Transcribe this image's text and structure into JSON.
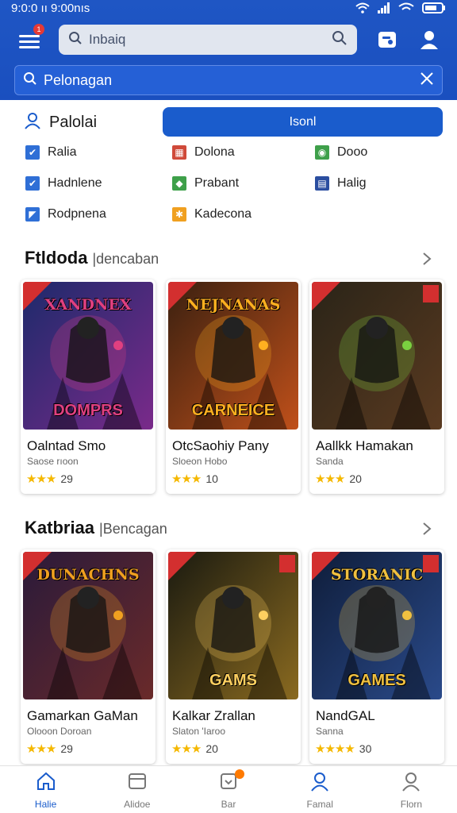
{
  "status_bar": {
    "time": "9:0:0 ıı 9:00nıs"
  },
  "header": {
    "menu_badge": "1",
    "search_text": "Inbaiq",
    "search_secondary": "Pelonagan"
  },
  "filters": {
    "profile_label": "Palolai",
    "primary_button": "Isonl",
    "items": [
      {
        "label": "Ralia",
        "color": "#2f6fd6",
        "glyph": "✔"
      },
      {
        "label": "Dolona",
        "color": "#d04a3a",
        "glyph": "▦"
      },
      {
        "label": "Dooo",
        "color": "#3ea04a",
        "glyph": "◉"
      },
      {
        "label": "Hadnlene",
        "color": "#2f6fd6",
        "glyph": "✔"
      },
      {
        "label": "Prabant",
        "color": "#3ea04a",
        "glyph": "◆"
      },
      {
        "label": "Halig",
        "color": "#2b4ea0",
        "glyph": "▤"
      },
      {
        "label": "Rodpnena",
        "color": "#2f6fd6",
        "glyph": "◤"
      },
      {
        "label": "Kadecona",
        "color": "#f0a020",
        "glyph": "✱"
      }
    ]
  },
  "sections": [
    {
      "title": "Ftldoda",
      "subtitle": "|dencaban",
      "cards": [
        {
          "title": "Oalntad Smo",
          "subtitle": "Saose rıoon",
          "rating_stars": 3,
          "rating": "29",
          "art_text": "XANDNEX",
          "art_bottom": "DOMPRS",
          "bg1": "#1d2a6b",
          "bg2": "#7a2a8a",
          "accent": "#e04080",
          "ribbon": true,
          "corner": false
        },
        {
          "title": "OtcSaohiy Pany",
          "subtitle": "Sloeon Hobo",
          "rating_stars": 3,
          "rating": "10",
          "art_text": "NEJNANAS",
          "art_bottom": "CARNEICE",
          "bg1": "#3a2010",
          "bg2": "#c0501a",
          "accent": "#ffb020",
          "ribbon": true,
          "corner": false
        },
        {
          "title": "Aallkk Hamakan",
          "subtitle": "Sanda",
          "rating_stars": 3,
          "rating": "20",
          "art_text": "",
          "art_bottom": "",
          "bg1": "#2a2418",
          "bg2": "#5a3a20",
          "accent": "#7ad040",
          "ribbon": true,
          "corner": true
        }
      ]
    },
    {
      "title": "Katbriaa",
      "subtitle": "|Bencagan",
      "cards": [
        {
          "title": "Gamarkan GaMan",
          "subtitle": "Olooon Doroan",
          "rating_stars": 3,
          "rating": "29",
          "art_text": "DUNACHNS",
          "art_bottom": "",
          "bg1": "#2a1a3a",
          "bg2": "#6a2a2a",
          "accent": "#f0a020",
          "ribbon": true,
          "corner": false
        },
        {
          "title": "Kalkar Zrallan",
          "subtitle": "Slaton 'Iaroo",
          "rating_stars": 3,
          "rating": "20",
          "art_text": "",
          "art_bottom": "GAMS",
          "bg1": "#1a1a10",
          "bg2": "#8a6a20",
          "accent": "#ffd060",
          "ribbon": true,
          "corner": true
        },
        {
          "title": "NandGAL",
          "subtitle": "Sanna",
          "rating_stars": 4,
          "rating": "30",
          "art_text": "STORANIC",
          "art_bottom": "GAMES",
          "bg1": "#0f1d3a",
          "bg2": "#2a4a8a",
          "accent": "#f0c040",
          "ribbon": true,
          "corner": true
        }
      ]
    }
  ],
  "bottom_nav": [
    {
      "label": "Halie",
      "icon": "home-icon",
      "active": true
    },
    {
      "label": "Alidoe",
      "icon": "library-icon",
      "active": false
    },
    {
      "label": "Bar",
      "icon": "download-icon",
      "active": false
    },
    {
      "label": "Famal",
      "icon": "profile-icon",
      "active": false
    },
    {
      "label": "Florn",
      "icon": "account-icon",
      "active": false
    }
  ],
  "colors": {
    "primary": "#1a5ccc",
    "header": "#1f56c4",
    "star": "#f5b800"
  }
}
